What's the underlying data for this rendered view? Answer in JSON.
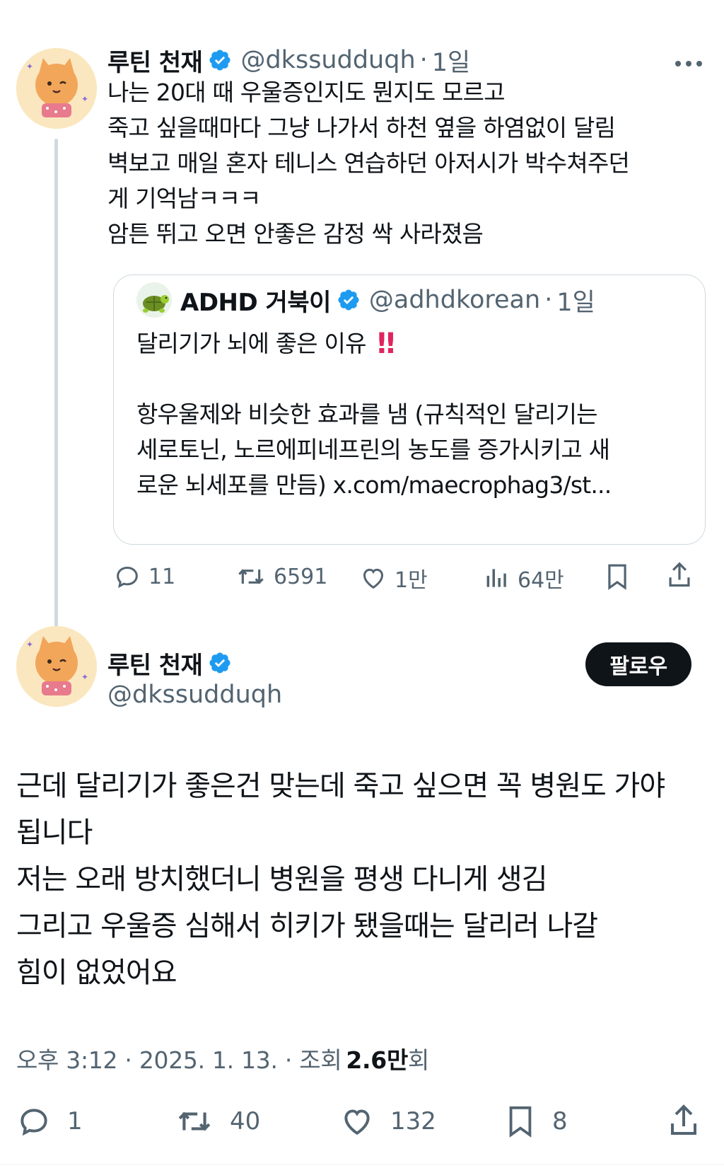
{
  "parent_tweet": {
    "display_name": "루틴 천재",
    "handle": "@dkssudduqh",
    "separator": "·",
    "time": "1일",
    "text_lines": [
      "나는 20대 때 우울증인지도 뭔지도 모르고",
      "죽고 싶을때마다 그냥 나가서 하천 옆을 하염없이 달림",
      "벽보고 매일 혼자 테니스 연습하던 아저시가 박수쳐주던",
      "게 기억남ㅋㅋㅋ",
      "암튼 뛰고 오면 안좋은 감정 싹 사라졌음"
    ],
    "quote": {
      "display_name": "ADHD 거북이",
      "handle": "@adhdkorean",
      "separator": "·",
      "time": "1일",
      "title": "달리기가 뇌에 좋은 이유",
      "title_emoji": "‼",
      "body_lines": [
        "항우울제와 비슷한 효과를 냄 (규칙적인 달리기는",
        "세로토닌, 노르에피네프린의 농도를 증가시키고 새",
        "로운 뇌세포를 만듬) x.com/maecrophag3/st..."
      ]
    },
    "actions": {
      "replies": "11",
      "retweets": "6591",
      "likes": "1만",
      "views": "64만"
    }
  },
  "main_tweet": {
    "display_name": "루틴 천재",
    "handle": "@dkssudduqh",
    "follow_label": "팔로우",
    "text_lines": [
      "근데 달리기가 좋은건 맞는데 죽고 싶으면 꼭 병원도 가야",
      "됩니다",
      "저는 오래 방치했더니 병원을 평생 다니게 생김",
      "그리고 우울증 심해서 히키가 됐을때는 달리러 나갈",
      "힘이 없었어요"
    ],
    "meta": {
      "time": "오후 3:12",
      "sep1": "·",
      "date": "2025. 1. 13.",
      "sep2": "·",
      "views_label": "조회",
      "views_count": "2.6만",
      "views_suffix": "회"
    },
    "actions": {
      "replies": "1",
      "retweets": "40",
      "likes": "132",
      "bookmarks": "8"
    }
  },
  "colors": {
    "verified": "#1d9bf0",
    "text": "#0f1419",
    "secondary": "#536471",
    "border": "#cfd9de"
  },
  "icons": {
    "avatar": "cat-avatar-icon",
    "quote_avatar": "turtle-avatar-icon",
    "verified": "verified-badge-icon",
    "more": "more-dots-icon",
    "reply": "reply-icon",
    "retweet": "retweet-icon",
    "like": "heart-icon",
    "views": "views-chart-icon",
    "bookmark": "bookmark-icon",
    "share": "share-icon"
  }
}
